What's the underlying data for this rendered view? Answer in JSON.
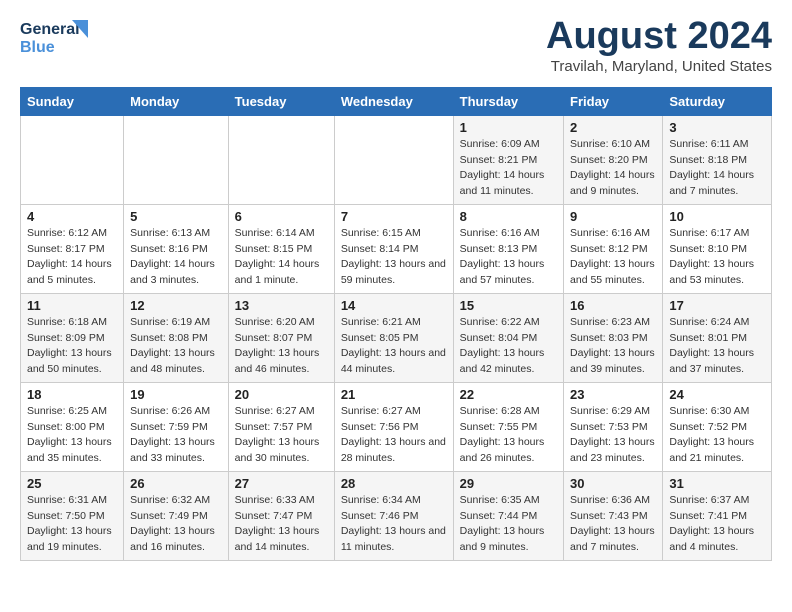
{
  "logo": {
    "line1": "General",
    "line2": "Blue"
  },
  "title": "August 2024",
  "subtitle": "Travilah, Maryland, United States",
  "days_of_week": [
    "Sunday",
    "Monday",
    "Tuesday",
    "Wednesday",
    "Thursday",
    "Friday",
    "Saturday"
  ],
  "weeks": [
    [
      {
        "day": "",
        "sunrise": "",
        "sunset": "",
        "daylight": ""
      },
      {
        "day": "",
        "sunrise": "",
        "sunset": "",
        "daylight": ""
      },
      {
        "day": "",
        "sunrise": "",
        "sunset": "",
        "daylight": ""
      },
      {
        "day": "",
        "sunrise": "",
        "sunset": "",
        "daylight": ""
      },
      {
        "day": "1",
        "sunrise": "Sunrise: 6:09 AM",
        "sunset": "Sunset: 8:21 PM",
        "daylight": "Daylight: 14 hours and 11 minutes."
      },
      {
        "day": "2",
        "sunrise": "Sunrise: 6:10 AM",
        "sunset": "Sunset: 8:20 PM",
        "daylight": "Daylight: 14 hours and 9 minutes."
      },
      {
        "day": "3",
        "sunrise": "Sunrise: 6:11 AM",
        "sunset": "Sunset: 8:18 PM",
        "daylight": "Daylight: 14 hours and 7 minutes."
      }
    ],
    [
      {
        "day": "4",
        "sunrise": "Sunrise: 6:12 AM",
        "sunset": "Sunset: 8:17 PM",
        "daylight": "Daylight: 14 hours and 5 minutes."
      },
      {
        "day": "5",
        "sunrise": "Sunrise: 6:13 AM",
        "sunset": "Sunset: 8:16 PM",
        "daylight": "Daylight: 14 hours and 3 minutes."
      },
      {
        "day": "6",
        "sunrise": "Sunrise: 6:14 AM",
        "sunset": "Sunset: 8:15 PM",
        "daylight": "Daylight: 14 hours and 1 minute."
      },
      {
        "day": "7",
        "sunrise": "Sunrise: 6:15 AM",
        "sunset": "Sunset: 8:14 PM",
        "daylight": "Daylight: 13 hours and 59 minutes."
      },
      {
        "day": "8",
        "sunrise": "Sunrise: 6:16 AM",
        "sunset": "Sunset: 8:13 PM",
        "daylight": "Daylight: 13 hours and 57 minutes."
      },
      {
        "day": "9",
        "sunrise": "Sunrise: 6:16 AM",
        "sunset": "Sunset: 8:12 PM",
        "daylight": "Daylight: 13 hours and 55 minutes."
      },
      {
        "day": "10",
        "sunrise": "Sunrise: 6:17 AM",
        "sunset": "Sunset: 8:10 PM",
        "daylight": "Daylight: 13 hours and 53 minutes."
      }
    ],
    [
      {
        "day": "11",
        "sunrise": "Sunrise: 6:18 AM",
        "sunset": "Sunset: 8:09 PM",
        "daylight": "Daylight: 13 hours and 50 minutes."
      },
      {
        "day": "12",
        "sunrise": "Sunrise: 6:19 AM",
        "sunset": "Sunset: 8:08 PM",
        "daylight": "Daylight: 13 hours and 48 minutes."
      },
      {
        "day": "13",
        "sunrise": "Sunrise: 6:20 AM",
        "sunset": "Sunset: 8:07 PM",
        "daylight": "Daylight: 13 hours and 46 minutes."
      },
      {
        "day": "14",
        "sunrise": "Sunrise: 6:21 AM",
        "sunset": "Sunset: 8:05 PM",
        "daylight": "Daylight: 13 hours and 44 minutes."
      },
      {
        "day": "15",
        "sunrise": "Sunrise: 6:22 AM",
        "sunset": "Sunset: 8:04 PM",
        "daylight": "Daylight: 13 hours and 42 minutes."
      },
      {
        "day": "16",
        "sunrise": "Sunrise: 6:23 AM",
        "sunset": "Sunset: 8:03 PM",
        "daylight": "Daylight: 13 hours and 39 minutes."
      },
      {
        "day": "17",
        "sunrise": "Sunrise: 6:24 AM",
        "sunset": "Sunset: 8:01 PM",
        "daylight": "Daylight: 13 hours and 37 minutes."
      }
    ],
    [
      {
        "day": "18",
        "sunrise": "Sunrise: 6:25 AM",
        "sunset": "Sunset: 8:00 PM",
        "daylight": "Daylight: 13 hours and 35 minutes."
      },
      {
        "day": "19",
        "sunrise": "Sunrise: 6:26 AM",
        "sunset": "Sunset: 7:59 PM",
        "daylight": "Daylight: 13 hours and 33 minutes."
      },
      {
        "day": "20",
        "sunrise": "Sunrise: 6:27 AM",
        "sunset": "Sunset: 7:57 PM",
        "daylight": "Daylight: 13 hours and 30 minutes."
      },
      {
        "day": "21",
        "sunrise": "Sunrise: 6:27 AM",
        "sunset": "Sunset: 7:56 PM",
        "daylight": "Daylight: 13 hours and 28 minutes."
      },
      {
        "day": "22",
        "sunrise": "Sunrise: 6:28 AM",
        "sunset": "Sunset: 7:55 PM",
        "daylight": "Daylight: 13 hours and 26 minutes."
      },
      {
        "day": "23",
        "sunrise": "Sunrise: 6:29 AM",
        "sunset": "Sunset: 7:53 PM",
        "daylight": "Daylight: 13 hours and 23 minutes."
      },
      {
        "day": "24",
        "sunrise": "Sunrise: 6:30 AM",
        "sunset": "Sunset: 7:52 PM",
        "daylight": "Daylight: 13 hours and 21 minutes."
      }
    ],
    [
      {
        "day": "25",
        "sunrise": "Sunrise: 6:31 AM",
        "sunset": "Sunset: 7:50 PM",
        "daylight": "Daylight: 13 hours and 19 minutes."
      },
      {
        "day": "26",
        "sunrise": "Sunrise: 6:32 AM",
        "sunset": "Sunset: 7:49 PM",
        "daylight": "Daylight: 13 hours and 16 minutes."
      },
      {
        "day": "27",
        "sunrise": "Sunrise: 6:33 AM",
        "sunset": "Sunset: 7:47 PM",
        "daylight": "Daylight: 13 hours and 14 minutes."
      },
      {
        "day": "28",
        "sunrise": "Sunrise: 6:34 AM",
        "sunset": "Sunset: 7:46 PM",
        "daylight": "Daylight: 13 hours and 11 minutes."
      },
      {
        "day": "29",
        "sunrise": "Sunrise: 6:35 AM",
        "sunset": "Sunset: 7:44 PM",
        "daylight": "Daylight: 13 hours and 9 minutes."
      },
      {
        "day": "30",
        "sunrise": "Sunrise: 6:36 AM",
        "sunset": "Sunset: 7:43 PM",
        "daylight": "Daylight: 13 hours and 7 minutes."
      },
      {
        "day": "31",
        "sunrise": "Sunrise: 6:37 AM",
        "sunset": "Sunset: 7:41 PM",
        "daylight": "Daylight: 13 hours and 4 minutes."
      }
    ]
  ]
}
